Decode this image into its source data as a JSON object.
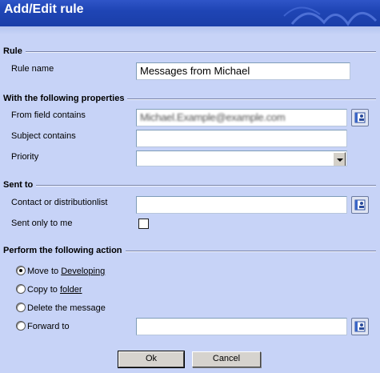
{
  "window": {
    "title": "Add/Edit rule"
  },
  "rule": {
    "heading": "Rule",
    "name_label": "Rule name",
    "name_value": "Messages from Michael"
  },
  "properties": {
    "heading": "With the following properties",
    "from_label": "From field contains",
    "from_value": "Michael.Example@example.com",
    "subject_label": "Subject contains",
    "subject_value": "",
    "priority_label": "Priority",
    "priority_value": ""
  },
  "sent_to": {
    "heading": "Sent to",
    "contact_label": "Contact or distributionlist",
    "contact_value": "",
    "only_me_label": "Sent only to me",
    "only_me_checked": false
  },
  "action": {
    "heading": "Perform the following action",
    "move_prefix": "Move to ",
    "move_link": "Developing",
    "copy_prefix": "Copy to ",
    "copy_link": "folder",
    "delete_label": "Delete the message",
    "forward_label": "Forward to",
    "forward_value": "",
    "selected": "move"
  },
  "buttons": {
    "ok": "Ok",
    "cancel": "Cancel"
  },
  "icons": {
    "address_book": "address-book-icon"
  },
  "colors": {
    "background": "#c7d3f7",
    "titlebar": "#1f45b5"
  }
}
